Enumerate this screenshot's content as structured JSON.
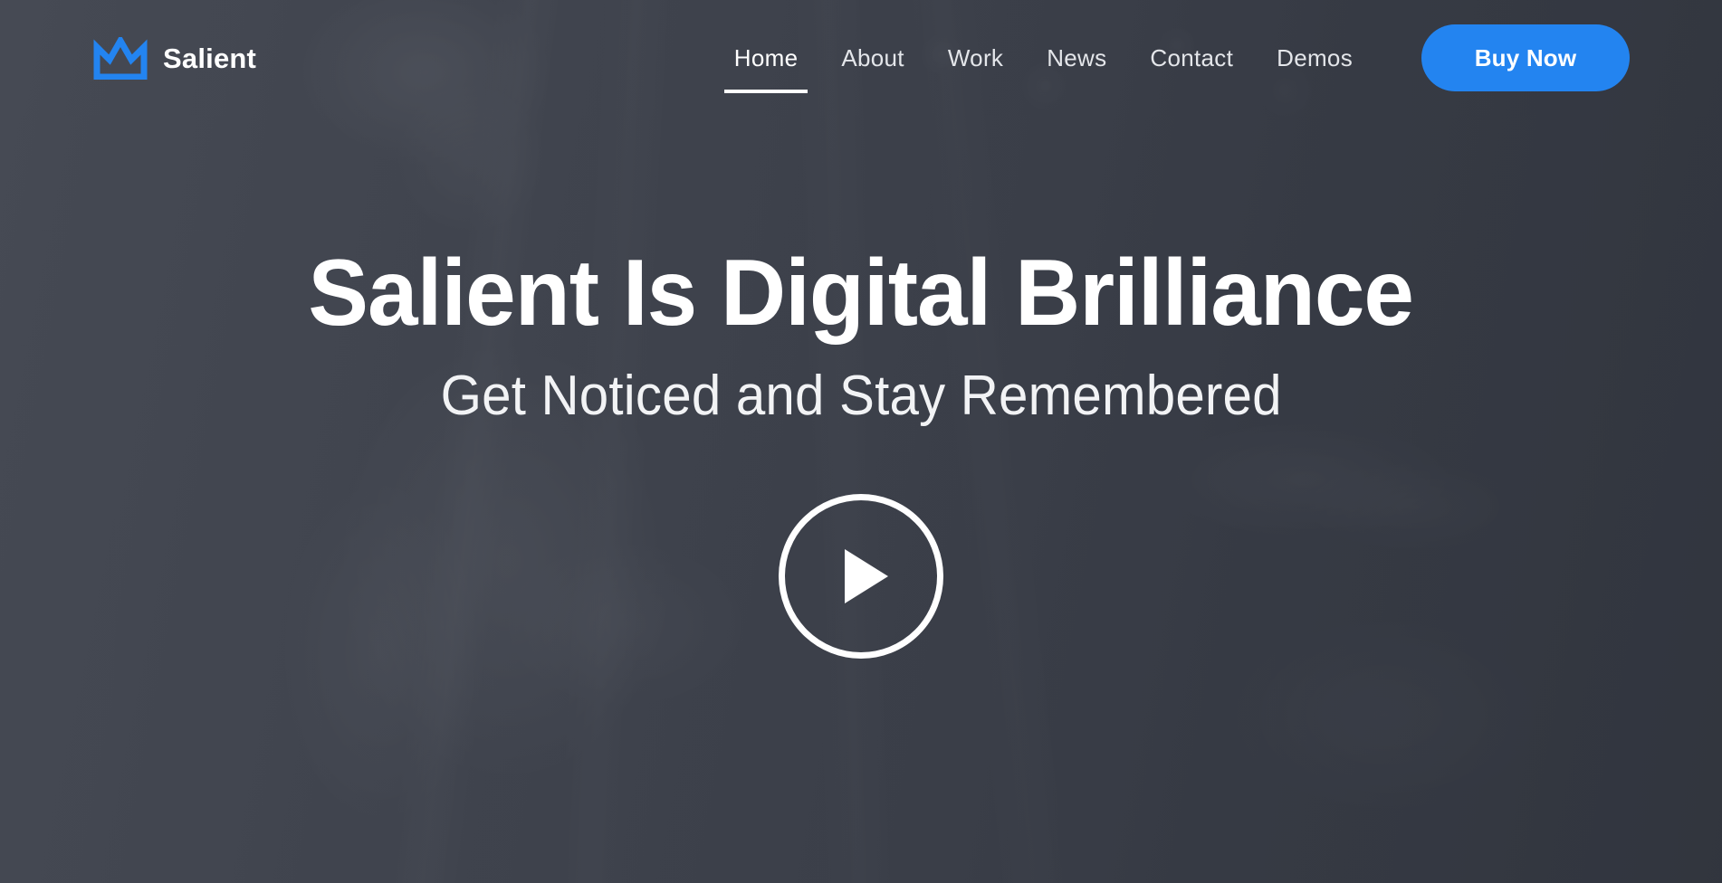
{
  "brand": {
    "name": "Salient",
    "logo_icon": "crown-icon",
    "logo_color": "#2384f0"
  },
  "nav": {
    "items": [
      {
        "label": "Home",
        "active": true
      },
      {
        "label": "About",
        "active": false
      },
      {
        "label": "Work",
        "active": false
      },
      {
        "label": "News",
        "active": false
      },
      {
        "label": "Contact",
        "active": false
      },
      {
        "label": "Demos",
        "active": false
      }
    ],
    "cta": {
      "label": "Buy Now",
      "background": "#2384f0",
      "text_color": "#ffffff"
    }
  },
  "hero": {
    "title": "Salient Is Digital Brilliance",
    "subtitle": "Get Noticed and Stay Remembered",
    "play_icon": "play-icon",
    "background_color": "#3f434e",
    "text_color": "#ffffff"
  }
}
